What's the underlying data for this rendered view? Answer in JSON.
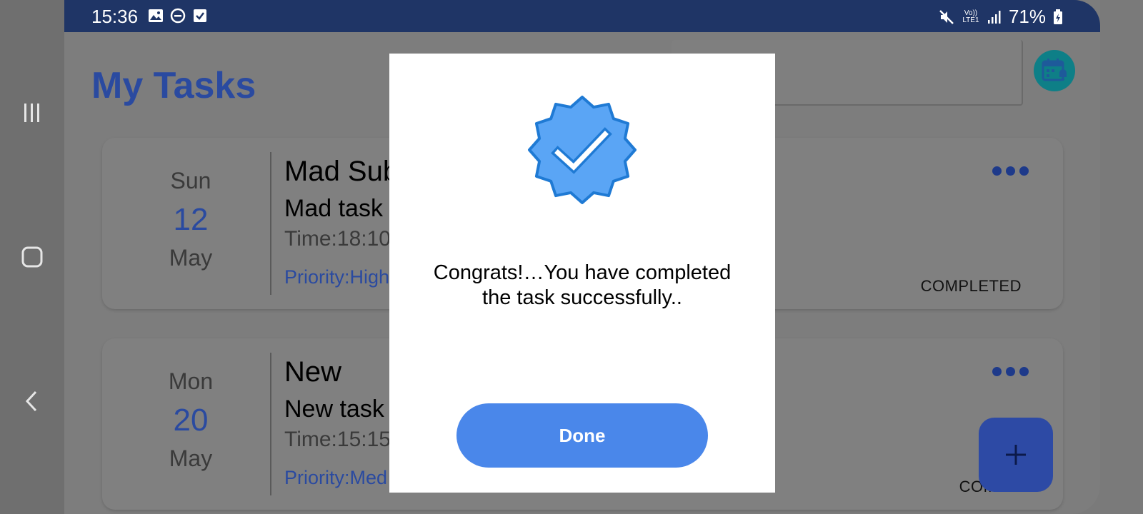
{
  "status_bar": {
    "time": "15:36",
    "network_label": "Vo)) LTE1",
    "battery": "71%"
  },
  "header": {
    "title": "My Tasks"
  },
  "tasks": [
    {
      "dow": "Sun",
      "day": "12",
      "month": "May",
      "title": "Mad Sub",
      "description": "Mad task",
      "time": "Time:18:10",
      "priority": "Priority:High",
      "status": "COMPLETED"
    },
    {
      "dow": "Mon",
      "day": "20",
      "month": "May",
      "title": "New",
      "description": "New task",
      "time": "Time:15:15",
      "priority": "Priority:Med",
      "status": "COMPLI"
    }
  ],
  "fab": {
    "label": "+"
  },
  "dialog": {
    "message": "Congrats!…You have completed the task successfully..",
    "button_label": "Done",
    "badge_icon": "verified-check-badge"
  },
  "colors": {
    "status_bar": "#1f3566",
    "accent": "#4a87ea",
    "title_blue": "#2a4aa0",
    "badge_blue": "#5aa5f5"
  }
}
